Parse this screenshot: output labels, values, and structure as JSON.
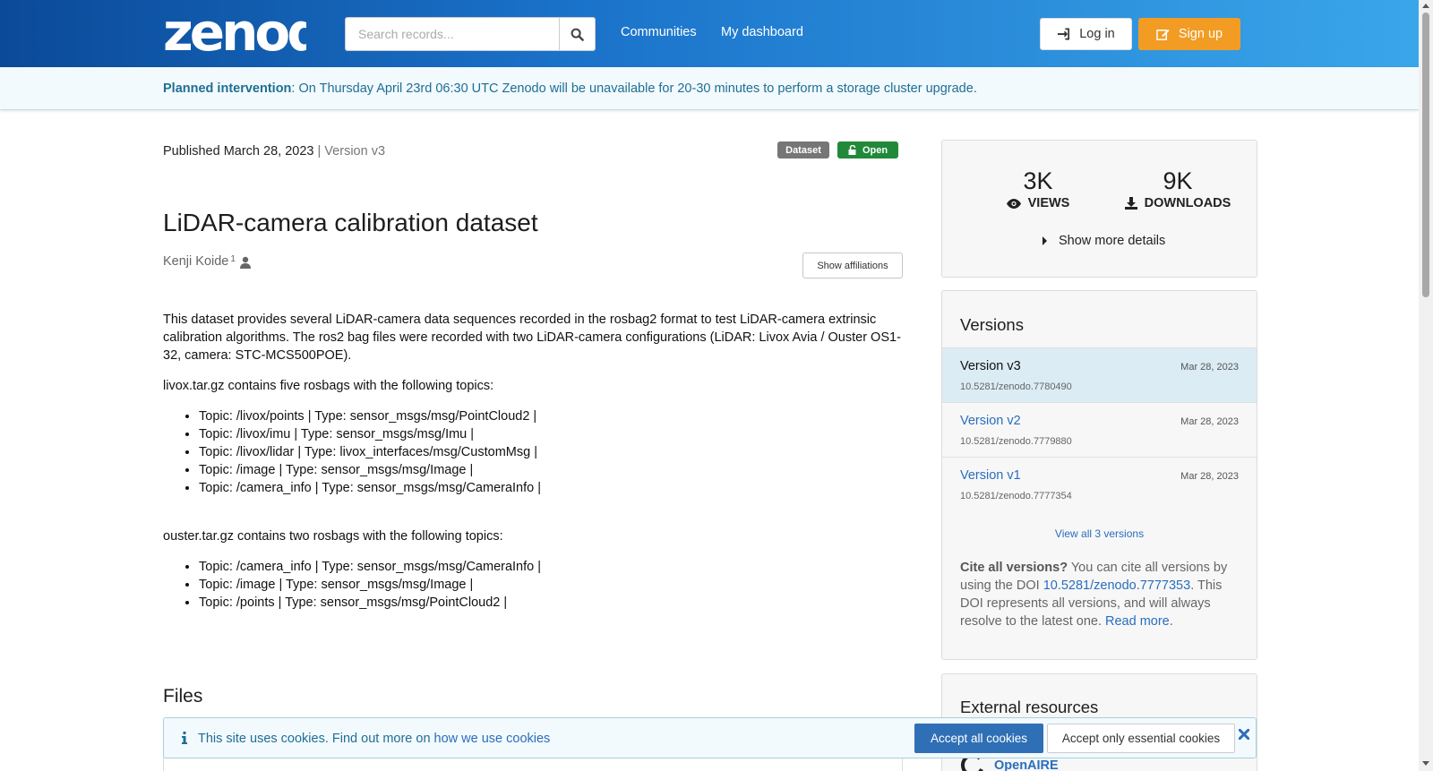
{
  "header": {
    "logo_text": "zenodo",
    "search_placeholder": "Search records...",
    "nav": [
      "Communities",
      "My dashboard"
    ],
    "login_label": "Log in",
    "signup_label": "Sign up",
    "colors": {
      "brand_dark": "#0b4a99",
      "brand_light": "#3aa6ea",
      "signup": "#f29c23"
    }
  },
  "announcement": {
    "label": "Planned intervention",
    "text": ": On Thursday April 23rd 06:30 UTC Zenodo will be unavailable for 20-30 minutes to perform a storage cluster upgrade."
  },
  "record": {
    "published": "Published March 28, 2023",
    "version": "| Version v3",
    "badge_type": "Dataset",
    "badge_access": "Open",
    "title": "LiDAR-camera calibration dataset",
    "author": "Kenji Koide",
    "author_affil_sup": "1",
    "show_affiliations": "Show affiliations",
    "description": {
      "intro": "This dataset provides several LiDAR-camera data sequences recorded in the rosbag2 format to test LiDAR-camera extrinsic calibration algorithms. The ros2 bag files were recorded with two LiDAR-camera configurations (LiDAR: Livox Avia / Ouster OS1-32, camera: STC-MCS500POE).",
      "livox_heading": "livox.tar.gz contains five rosbags with the following topics:",
      "livox_topics": [
        "Topic: /livox/points | Type: sensor_msgs/msg/PointCloud2 |",
        "Topic: /livox/imu | Type: sensor_msgs/msg/Imu |",
        "Topic: /livox/lidar | Type: livox_interfaces/msg/CustomMsg |",
        "Topic: /image | Type: sensor_msgs/msg/Image |",
        "Topic: /camera_info | Type: sensor_msgs/msg/CameraInfo |"
      ],
      "ouster_heading": "ouster.tar.gz contains two rosbags with the following topics:",
      "ouster_topics": [
        "Topic: /camera_info | Type: sensor_msgs/msg/CameraInfo |",
        "Topic: /image | Type: sensor_msgs/msg/Image |",
        "Topic: /points | Type: sensor_msgs/msg/PointCloud2 |"
      ]
    },
    "files_heading": "Files"
  },
  "cookie": {
    "text": "This site uses cookies. Find out more on ",
    "link": "how we use cookies",
    "accept_all": "Accept all cookies",
    "accept_essential": "Accept only essential cookies"
  },
  "sidebar": {
    "views_num": "3K",
    "views_label": "VIEWS",
    "downloads_num": "9K",
    "downloads_label": "DOWNLOADS",
    "show_more": "Show more details",
    "versions_heading": "Versions",
    "versions": [
      {
        "name": "Version v3",
        "doi": "10.5281/zenodo.7780490",
        "date": "Mar 28, 2023"
      },
      {
        "name": "Version v2",
        "doi": "10.5281/zenodo.7779880",
        "date": "Mar 28, 2023"
      },
      {
        "name": "Version v1",
        "doi": "10.5281/zenodo.7777354",
        "date": "Mar 28, 2023"
      }
    ],
    "view_all": "View all 3 versions",
    "cite_bold": "Cite all versions?",
    "cite_text1": " You can cite all versions by using the DOI ",
    "cite_doi": "10.5281/zenodo.7777353",
    "cite_text2": ". This DOI represents all versions, and will always resolve to the latest one. ",
    "cite_read_more": "Read more",
    "cite_end": ".",
    "external_heading": "External resources",
    "openaire": "OpenAIRE"
  }
}
